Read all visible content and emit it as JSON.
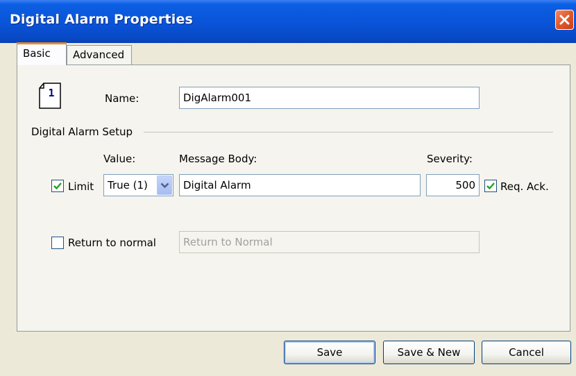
{
  "window": {
    "title": "Digital Alarm Properties",
    "close_icon": "close-icon"
  },
  "tabs": [
    {
      "label": "Basic",
      "active": true
    },
    {
      "label": "Advanced",
      "active": false
    }
  ],
  "basic": {
    "doc_icon_number": "1",
    "name_label": "Name:",
    "name_value": "DigAlarm001",
    "group_label": "Digital Alarm Setup",
    "value_header": "Value:",
    "message_header": "Message Body:",
    "severity_header": "Severity:",
    "limit": {
      "checked": true,
      "label": "Limit",
      "value_selected": "True (1)",
      "message": "Digital Alarm",
      "severity": "500",
      "req_ack_checked": true,
      "req_ack_label": "Req. Ack."
    },
    "return_to_normal": {
      "checked": false,
      "label": "Return to normal",
      "message_placeholder": "Return to Normal"
    }
  },
  "buttons": {
    "save": "Save",
    "save_new": "Save & New",
    "cancel": "Cancel"
  },
  "colors": {
    "titlebar": "#0a53d8",
    "tab_accent": "#e68b2c",
    "close": "#e0582c"
  }
}
